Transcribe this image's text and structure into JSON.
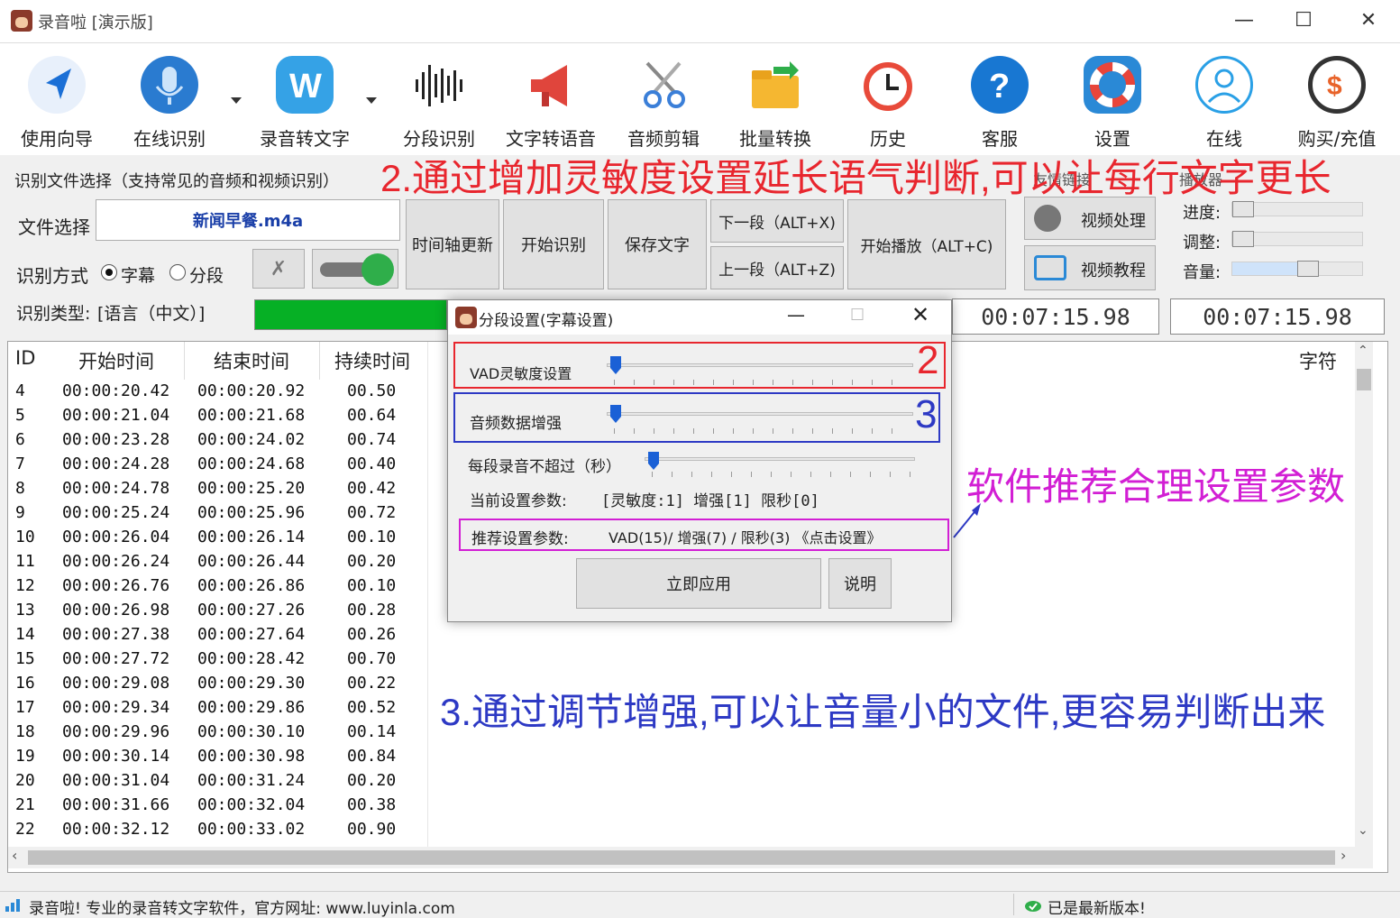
{
  "window": {
    "title": "录音啦 [演示版]",
    "minimize": "—",
    "maximize": "☐",
    "close": "✕"
  },
  "toolbar": {
    "items": [
      {
        "label": "使用向导",
        "icon": "navigation-arrow-icon",
        "color": "#1a6fd6"
      },
      {
        "label": "在线识别",
        "icon": "microphone-icon",
        "color": "#2a7bd0"
      },
      {
        "label": "录音转文字",
        "icon": "w-letter-icon",
        "color": "#35a2e6"
      },
      {
        "label": "分段识别",
        "icon": "soundwave-icon",
        "color": "#222222"
      },
      {
        "label": "文字转语音",
        "icon": "megaphone-icon",
        "color": "#e0453c"
      },
      {
        "label": "音频剪辑",
        "icon": "scissors-icon",
        "color": "#3b7fd8"
      },
      {
        "label": "批量转换",
        "icon": "folder-icon",
        "color": "#f5b731"
      },
      {
        "label": "历史",
        "icon": "history-clock-icon",
        "color": "#e84a3a"
      },
      {
        "label": "客服",
        "icon": "help-question-icon",
        "color": "#1877d2"
      },
      {
        "label": "设置",
        "icon": "lifebuoy-icon",
        "color": "#e8453a"
      },
      {
        "label": "在线",
        "icon": "user-online-icon",
        "color": "#2aa0e6"
      },
      {
        "label": "购买/充值",
        "icon": "dollar-coin-icon",
        "color": "#333333"
      }
    ]
  },
  "file_panel": {
    "group_title": "识别文件选择（支持常见的音频和视频识别）",
    "file_label": "文件选择",
    "file_value": "新闻早餐.m4a",
    "mode_label": "识别方式",
    "mode_options": [
      "字幕",
      "分段"
    ],
    "type_label": "识别类型:",
    "type_value": "[语言（中文）]"
  },
  "actions": {
    "timeline_update": "时间轴更新",
    "start_recognition": "开始识别",
    "save_text": "保存文字",
    "next_segment": "下一段（ALT+X)",
    "prev_segment": "上一段（ALT+Z)",
    "start_play": "开始播放（ALT+C)"
  },
  "links": {
    "group_title": "友情链接",
    "video_process": "视频处理",
    "video_tutorial": "视频教程"
  },
  "player": {
    "group_title": "播放器",
    "progress_label": "进度:",
    "adjust_label": "调整:",
    "volume_label": "音量:",
    "progress_level": 0.0,
    "adjust_level": 0.0,
    "volume_level": 0.55,
    "time_current": "00:07:15.98",
    "time_total": "00:07:15.98"
  },
  "annotations": {
    "top_red": "2.通过增加灵敏度设置延长语气判断,可以让每行文字更长",
    "mag": "软件推荐合理设置参数",
    "bottom_blue": "3.通过调节增强,可以让音量小的文件,更容易判断出来",
    "num2": "2",
    "num3": "3"
  },
  "table": {
    "headers": [
      "ID",
      "开始时间",
      "结束时间",
      "持续时间",
      "字符"
    ],
    "rows": [
      [
        "4",
        "00:00:20.42",
        "00:00:20.92",
        "00.50"
      ],
      [
        "5",
        "00:00:21.04",
        "00:00:21.68",
        "00.64"
      ],
      [
        "6",
        "00:00:23.28",
        "00:00:24.02",
        "00.74"
      ],
      [
        "7",
        "00:00:24.28",
        "00:00:24.68",
        "00.40"
      ],
      [
        "8",
        "00:00:24.78",
        "00:00:25.20",
        "00.42"
      ],
      [
        "9",
        "00:00:25.24",
        "00:00:25.96",
        "00.72"
      ],
      [
        "10",
        "00:00:26.04",
        "00:00:26.14",
        "00.10"
      ],
      [
        "11",
        "00:00:26.24",
        "00:00:26.44",
        "00.20"
      ],
      [
        "12",
        "00:00:26.76",
        "00:00:26.86",
        "00.10"
      ],
      [
        "13",
        "00:00:26.98",
        "00:00:27.26",
        "00.28"
      ],
      [
        "14",
        "00:00:27.38",
        "00:00:27.64",
        "00.26"
      ],
      [
        "15",
        "00:00:27.72",
        "00:00:28.42",
        "00.70"
      ],
      [
        "16",
        "00:00:29.08",
        "00:00:29.30",
        "00.22"
      ],
      [
        "17",
        "00:00:29.34",
        "00:00:29.86",
        "00.52"
      ],
      [
        "18",
        "00:00:29.96",
        "00:00:30.10",
        "00.14"
      ],
      [
        "19",
        "00:00:30.14",
        "00:00:30.98",
        "00.84"
      ],
      [
        "20",
        "00:00:31.04",
        "00:00:31.24",
        "00.20"
      ],
      [
        "21",
        "00:00:31.66",
        "00:00:32.04",
        "00.38"
      ],
      [
        "22",
        "00:00:32.12",
        "00:00:33.02",
        "00.90"
      ]
    ]
  },
  "dialog": {
    "title": "分段设置(字幕设置)",
    "vad_label": "VAD灵敏度设置",
    "enhance_label": "音频数据增强",
    "limit_label": "每段录音不超过（秒）",
    "current_label": "当前设置参数:",
    "current_value": "[灵敏度:1] 增强[1] 限秒[0]",
    "recommend_label": "推荐设置参数:",
    "recommend_value": "VAD(15)/ 增强(7)  / 限秒(3) 《点击设置》",
    "apply_button": "立即应用",
    "help_button": "说明",
    "vad_level": 0.0,
    "enhance_level": 0.0,
    "limit_level": 0.0
  },
  "status": {
    "left_text": "录音啦! 专业的录音转文字软件，官方网址: www.luyinla.com",
    "right_text": "已是最新版本!"
  }
}
